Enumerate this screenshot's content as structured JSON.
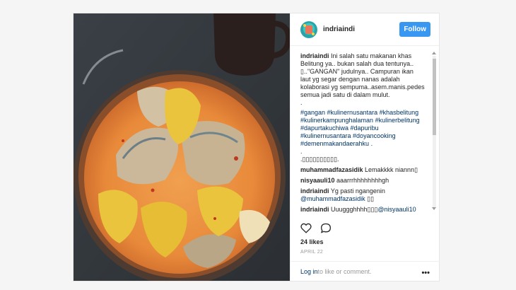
{
  "post": {
    "username": "indriaindi",
    "follow_label": "Follow",
    "caption_user": "indriaindi",
    "caption_text": " Ini salah satu makanan khas\nBelitung ya.. bukan salah dua tentunya..\n▯..\"GANGAN\" judulnya.. Campuran ikan\nlaut yg segar dengan nanas adalah\nkolaborasi yg sempuma..asem.manis.pedes\nsemua jadi satu di dalam mulut.\n.",
    "hashtags": "#gangan #kulinernusantara #khasbelitung\n#kulinerkampunghalaman #kulinerbelitung\n#dapurtakuchiwa #dapuribu\n#kulinernusantara #doyancooking\n#demenmakandaerahku .",
    "dots": ".\n.▯▯▯▯▯▯▯▯▯▯.",
    "comments": [
      {
        "user": "muhammadfazasidik",
        "text": " Lemakkkk niannn▯"
      },
      {
        "user": "nisyaauli10",
        "text": " aaarrrhhhhhhhhgh"
      },
      {
        "user": "indriaindi",
        "text": " Yg pasti ngangenin",
        "mention": "@muhammadfazasidik",
        "after": " ▯▯"
      },
      {
        "user": "indriaindi",
        "text": " Uuuggghhhh▯▯▯",
        "mention": "@nisyaauli10",
        "after": ""
      }
    ],
    "likes": "24 likes",
    "date": "APRIL 22",
    "login_link": "Log in",
    "login_rest": " to like or comment."
  },
  "icons": {
    "heart": "heart-icon",
    "comment": "comment-icon",
    "more": "more-options-icon"
  },
  "colors": {
    "follow": "#3897f0",
    "link": "#003569",
    "muted": "#999999"
  }
}
